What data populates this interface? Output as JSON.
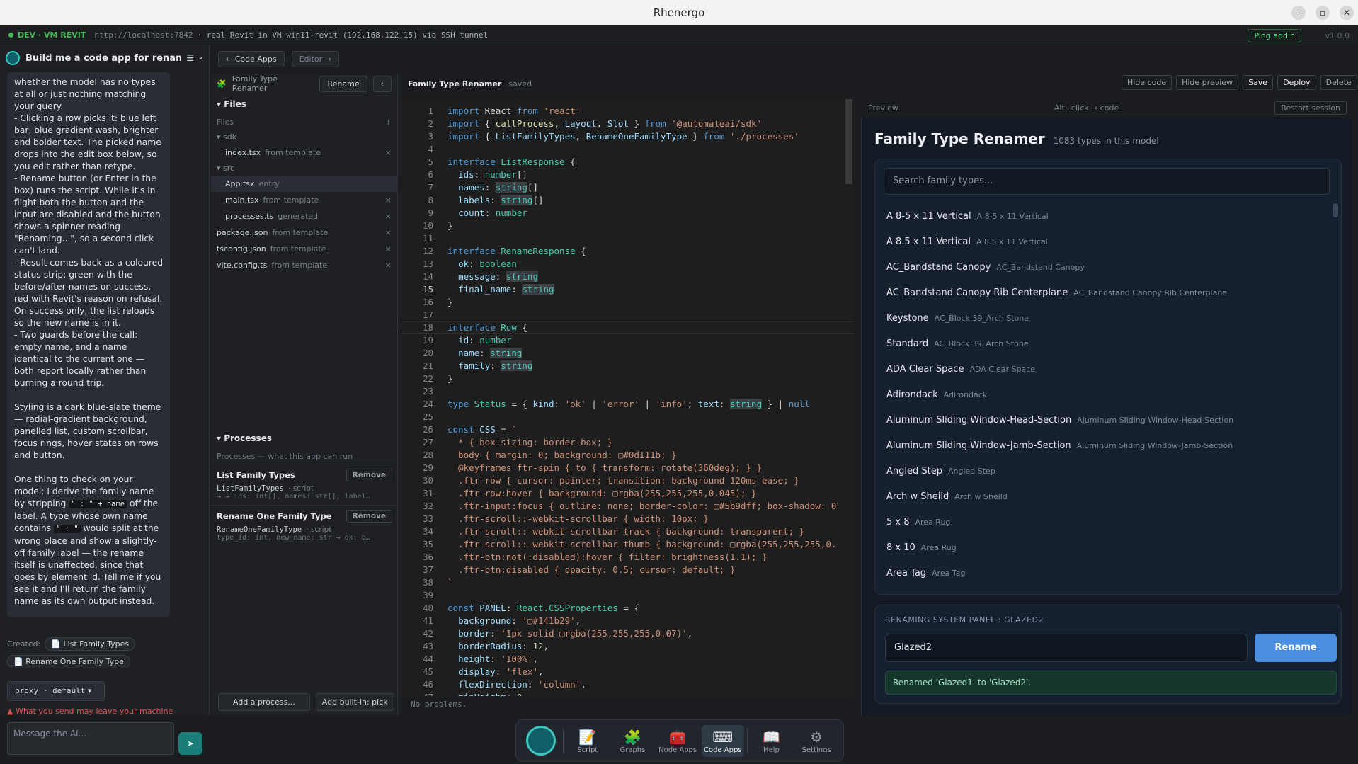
{
  "window": {
    "title": "Rhenergo"
  },
  "devbar": {
    "env": "DEV · VM REVIT",
    "url": "http://localhost:7842",
    "info": "· real Revit in VM win11-revit (192.168.122.15) via SSH tunnel",
    "ping": "Ping addin",
    "version": "v1.0.0"
  },
  "chat": {
    "title": "Build me a code app for renamin...",
    "paragraphs": [
      "whether the model has no types at all or just nothing matching your query.\n- Clicking a row picks it: blue left bar, blue gradient wash, brighter and bolder text. The picked name drops into the edit box below, so you edit rather than retype.\n- Rename button (or Enter in the box) runs the script. While it's in flight both the button and the input are disabled and the button shows a spinner reading \"Renaming...\", so a second click can't land.\n- Result comes back as a coloured status strip: green with the before/after names on success, red with Revit's reason on refusal. On success only, the list reloads so the new name is in it.\n- Two guards before the call: empty name, and a name identical to the current one — both report locally rather than burning a round trip.",
      "Styling is a dark blue-slate theme — radial-gradient background, panelled list, custom scrollbar, focus rings, hover states on rows and button."
    ],
    "p3_a": "One thing to check on your model: I derive the family name by stripping",
    "p3_code1": "\" : \" + name",
    "p3_b": "off the label. A type whose own name contains",
    "p3_code2": "\" : \"",
    "p3_c": "would split at the wrong place and show a slightly-off family label — the rename itself is unaffected, since that goes by element id. Tell me if you see it and I'll return the family name as its own output instead.",
    "created_label": "Created:",
    "created": [
      "List Family Types",
      "Rename One Family Type"
    ],
    "proxy": "proxy · default",
    "warning": "What you send may leave your machine",
    "message_placeholder": "Message the AI..."
  },
  "toptabs": {
    "back": "← Code Apps",
    "editor": "Editor →"
  },
  "files": {
    "app_name": "Family Type Renamer",
    "rename": "Rename",
    "section": "Files",
    "sub": "Files",
    "folders": {
      "sdk": "sdk",
      "src": "src"
    },
    "items": [
      {
        "name": "index.tsx",
        "tag": "from template"
      },
      {
        "name": "App.tsx",
        "tag": "entry"
      },
      {
        "name": "main.tsx",
        "tag": "from template"
      },
      {
        "name": "processes.ts",
        "tag": "generated"
      },
      {
        "name": "package.json",
        "tag": "from template"
      },
      {
        "name": "tsconfig.json",
        "tag": "from template"
      },
      {
        "name": "vite.config.ts",
        "tag": "from template"
      }
    ],
    "processes_title": "Processes",
    "processes_sub": "Processes — what this app can run",
    "processes": [
      {
        "title": "List Family Types",
        "script": "ListFamilyTypes",
        "kind": "· script",
        "sig": "→ → ids: int[], names: str[], label…",
        "remove": "Remove"
      },
      {
        "title": "Rename One Family Type",
        "script": "RenameOneFamilyType",
        "kind": "· script",
        "sig": "type_id: int, new_name: str → ok: b…",
        "remove": "Remove"
      }
    ],
    "add_process": "Add a process...",
    "add_builtin": "Add built-in: pick"
  },
  "editor": {
    "name": "Family Type Renamer",
    "status": "saved",
    "tools": [
      "Hide code",
      "Hide preview",
      "Save",
      "Deploy",
      "Delete"
    ],
    "problems": "No problems."
  },
  "preview": {
    "label": "Preview",
    "hint": "Alt+click → code",
    "restart": "Restart session",
    "title": "Family Type Renamer",
    "count": "1083 types in this model",
    "search_placeholder": "Search family types...",
    "rows": [
      {
        "name": "A 8-5 x 11 Vertical",
        "family": "A 8-5 x 11 Vertical"
      },
      {
        "name": "A 8.5 x 11 Vertical",
        "family": "A 8.5 x 11 Vertical"
      },
      {
        "name": "AC_Bandstand Canopy",
        "family": "AC_Bandstand Canopy"
      },
      {
        "name": "AC_Bandstand Canopy Rib Centerplane",
        "family": "AC_Bandstand Canopy Rib Centerplane"
      },
      {
        "name": "Keystone",
        "family": "AC_Block 39_Arch Stone"
      },
      {
        "name": "Standard",
        "family": "AC_Block 39_Arch Stone"
      },
      {
        "name": "ADA Clear Space",
        "family": "ADA Clear Space"
      },
      {
        "name": "Adirondack",
        "family": "Adirondack"
      },
      {
        "name": "Aluminum Sliding Window-Head-Section",
        "family": "Aluminum Sliding Window-Head-Section"
      },
      {
        "name": "Aluminum Sliding Window-Jamb-Section",
        "family": "Aluminum Sliding Window-Jamb-Section"
      },
      {
        "name": "Angled Step",
        "family": "Angled Step"
      },
      {
        "name": "Arch w Sheild",
        "family": "Arch w Sheild"
      },
      {
        "name": "5 x 8",
        "family": "Area Rug"
      },
      {
        "name": "8 x 10",
        "family": "Area Rug"
      },
      {
        "name": "Area Tag",
        "family": "Area Tag"
      }
    ],
    "rename_label": "RENAMING SYSTEM PANEL : GLAZED2",
    "rename_value": "Glazed2",
    "rename_button": "Rename",
    "result": "Renamed 'Glazed1' to 'Glazed2'."
  },
  "dock": [
    {
      "label": "",
      "icon": "robot-icon"
    },
    {
      "label": "Script",
      "icon": "note-icon"
    },
    {
      "label": "Graphs",
      "icon": "puzzle-icon"
    },
    {
      "label": "Node Apps",
      "icon": "toolbox-icon"
    },
    {
      "label": "Code Apps",
      "icon": "keyboard-icon"
    },
    {
      "label": "Help",
      "icon": "book-icon"
    },
    {
      "label": "Settings",
      "icon": "gear-icon"
    }
  ]
}
